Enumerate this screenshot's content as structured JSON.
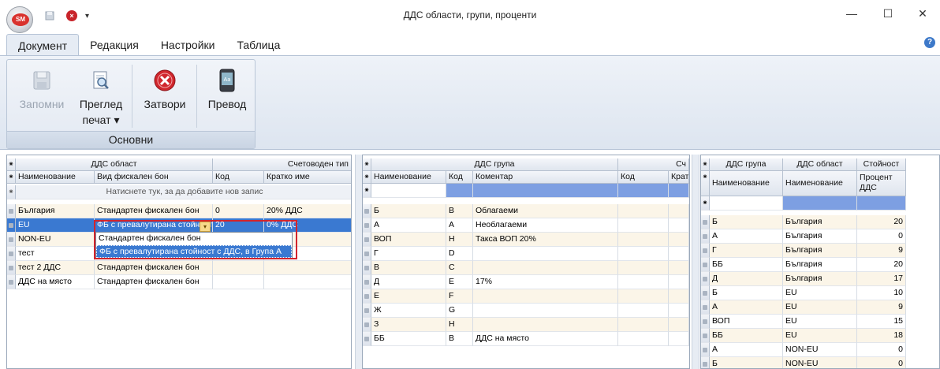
{
  "window": {
    "title": "ДДС области, групи, проценти",
    "logo": "SM",
    "min": "—",
    "max": "☐",
    "close": "✕",
    "help": "?"
  },
  "ribbon": {
    "tabs": [
      "Документ",
      "Редакция",
      "Настройки",
      "Таблица"
    ],
    "buttons": {
      "save": "Запомни",
      "preview1": "Преглед",
      "preview2": "печат ▾",
      "close": "Затвори",
      "translate": "Превод"
    },
    "group_label": "Основни"
  },
  "left": {
    "band1": "ДДС област",
    "band2": "Счетоводен тип",
    "cols": [
      "Наименование",
      "Вид фискален бон",
      "Код",
      "Кратко име"
    ],
    "new_row": "Натиснете тук, за да добавите нов запис",
    "rows": [
      [
        "България",
        "Стандартен фискален бон",
        "0",
        "20% ДДС"
      ],
      [
        "EU",
        "ФБ с превалутирана стойност",
        "20",
        "0% ДДС"
      ],
      [
        "NON-EU",
        "",
        "",
        ""
      ],
      [
        "тест",
        "",
        "",
        ""
      ],
      [
        "тест 2 ДДС",
        "Стандартен фискален бон",
        "",
        ""
      ],
      [
        "ДДС на място",
        "Стандартен фискален бон",
        "",
        ""
      ]
    ],
    "dropdown": [
      "Стандартен фискален бон",
      "ФБ с превалутирана стойност с ДДС, в Група А"
    ]
  },
  "middle": {
    "band1": "ДДС група",
    "band2": "Сч",
    "cols": [
      "Наименование",
      "Код",
      "Коментар",
      "Код",
      "Крат"
    ],
    "rows": [
      [
        "Б",
        "B",
        "Облагаеми"
      ],
      [
        "А",
        "A",
        "Необлагаеми"
      ],
      [
        "ВОП",
        "H",
        "Такса ВОП 20%"
      ],
      [
        "Г",
        "D",
        ""
      ],
      [
        "В",
        "C",
        ""
      ],
      [
        "Д",
        "E",
        "17%"
      ],
      [
        "Е",
        "F",
        ""
      ],
      [
        "Ж",
        "G",
        ""
      ],
      [
        "З",
        "H",
        ""
      ],
      [
        "ББ",
        "B",
        "ДДС на място"
      ]
    ]
  },
  "right": {
    "band1": "ДДС група",
    "band2": "ДДС област",
    "band3": "Стойност",
    "col1": "Наименование",
    "col2": "Наименование",
    "col3a": "Процент",
    "col3b": "ДДС",
    "rows": [
      [
        "Б",
        "България",
        "20"
      ],
      [
        "А",
        "България",
        "0"
      ],
      [
        "Г",
        "България",
        "9"
      ],
      [
        "ББ",
        "България",
        "20"
      ],
      [
        "Д",
        "България",
        "17"
      ],
      [
        "Б",
        "EU",
        "10"
      ],
      [
        "А",
        "EU",
        "9"
      ],
      [
        "ВОП",
        "EU",
        "15"
      ],
      [
        "ББ",
        "EU",
        "18"
      ],
      [
        "А",
        "NON-EU",
        "0"
      ],
      [
        "Б",
        "NON-EU",
        "0"
      ]
    ]
  },
  "colors": {
    "accent": "#3a79d1",
    "highlight_border": "#d2242c",
    "filter": "#7d9fe2"
  }
}
